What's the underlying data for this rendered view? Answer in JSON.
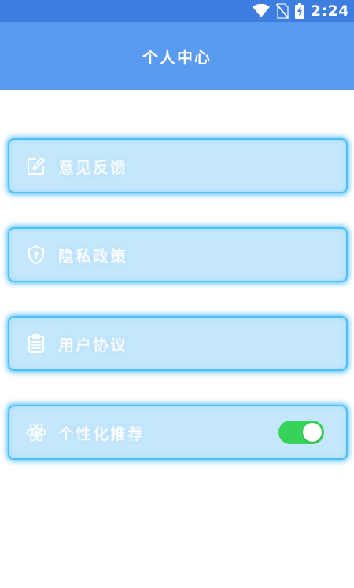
{
  "status_bar": {
    "time": "2:24",
    "icons": [
      "wifi-icon",
      "no-sim-icon",
      "battery-charging-icon"
    ]
  },
  "header": {
    "title": "个人中心"
  },
  "menu": {
    "items": [
      {
        "label": "意见反馈",
        "icon": "edit-icon"
      },
      {
        "label": "隐私政策",
        "icon": "shield-icon"
      },
      {
        "label": "用户协议",
        "icon": "clipboard-icon"
      },
      {
        "label": "个性化推荐",
        "icon": "atom-icon",
        "toggle_on": true
      }
    ]
  },
  "colors": {
    "status_bar_bg": "#3d7ee0",
    "header_bg": "#5a9bf2",
    "card_bg": "#c4e7fb",
    "card_border": "#4cc1f7",
    "toggle_on": "#37d25a"
  }
}
